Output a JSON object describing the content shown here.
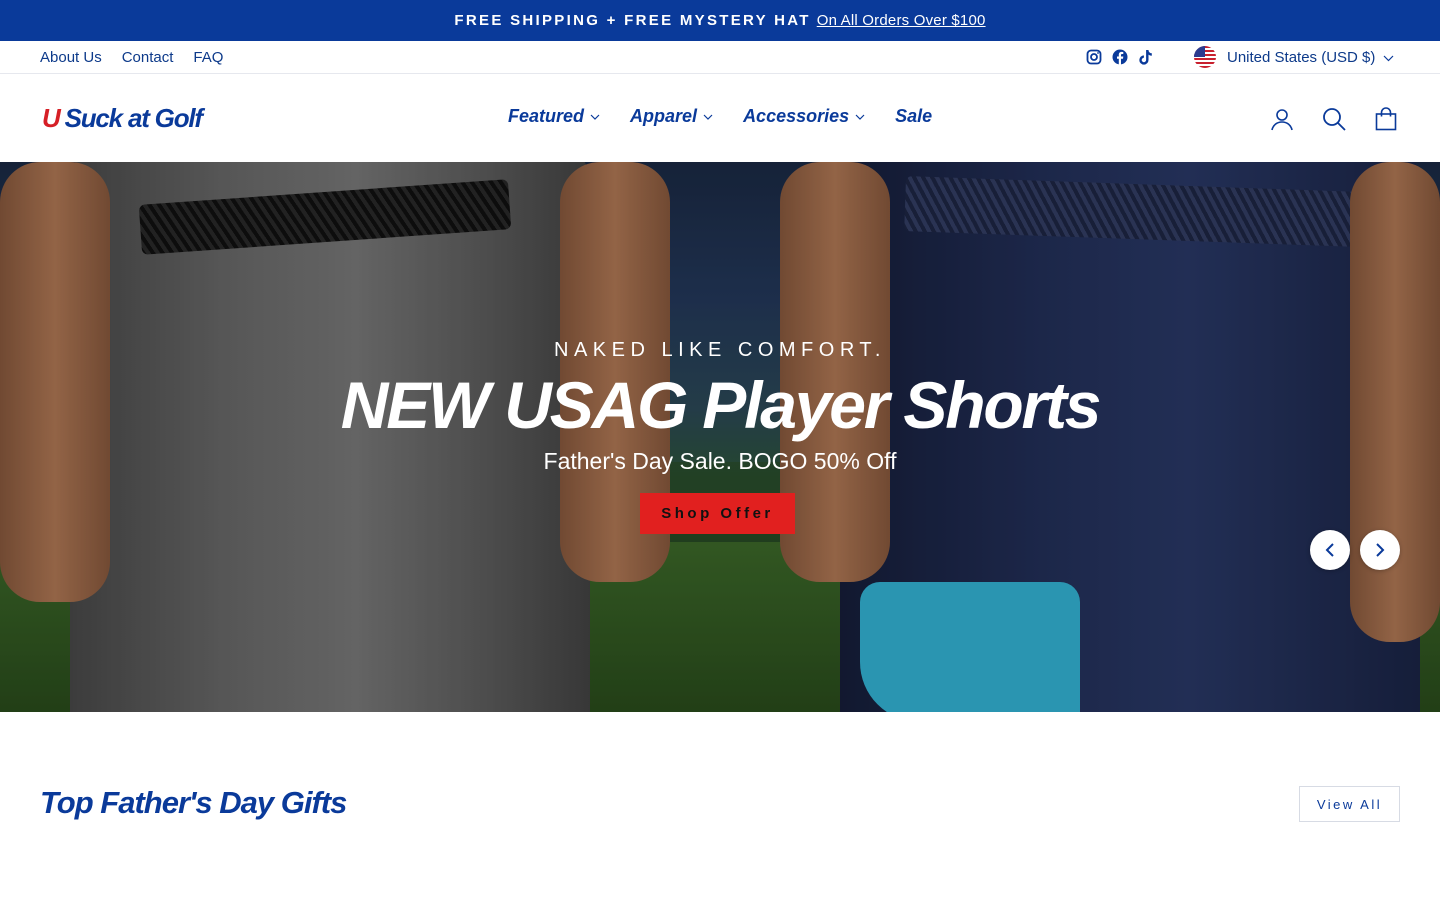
{
  "announcement": {
    "strong_text": "FREE SHIPPING + FREE MYSTERY HAT",
    "link_text": "On All Orders Over $100"
  },
  "utility": {
    "links": [
      "About Us",
      "Contact",
      "FAQ"
    ],
    "social_icons": [
      "instagram-icon",
      "facebook-icon",
      "tiktok-icon"
    ],
    "currency": "United States (USD $)"
  },
  "header": {
    "logo_u": "U",
    "logo_rest": "Suck at Golf",
    "nav": [
      "Featured",
      "Apparel",
      "Accessories",
      "Sale"
    ],
    "icons": [
      "account-icon",
      "search-icon",
      "cart-icon"
    ]
  },
  "hero": {
    "eyebrow": "NAKED LIKE COMFORT.",
    "headline": "NEW USAG Player Shorts",
    "subline": "Father's Day Sale. BOGO 50% Off",
    "cta": "Shop Offer"
  },
  "section": {
    "title": "Top Father's Day Gifts",
    "view_all": "View All"
  },
  "colors": {
    "brand_blue": "#0a3a9a",
    "brand_red": "#e1201f"
  }
}
